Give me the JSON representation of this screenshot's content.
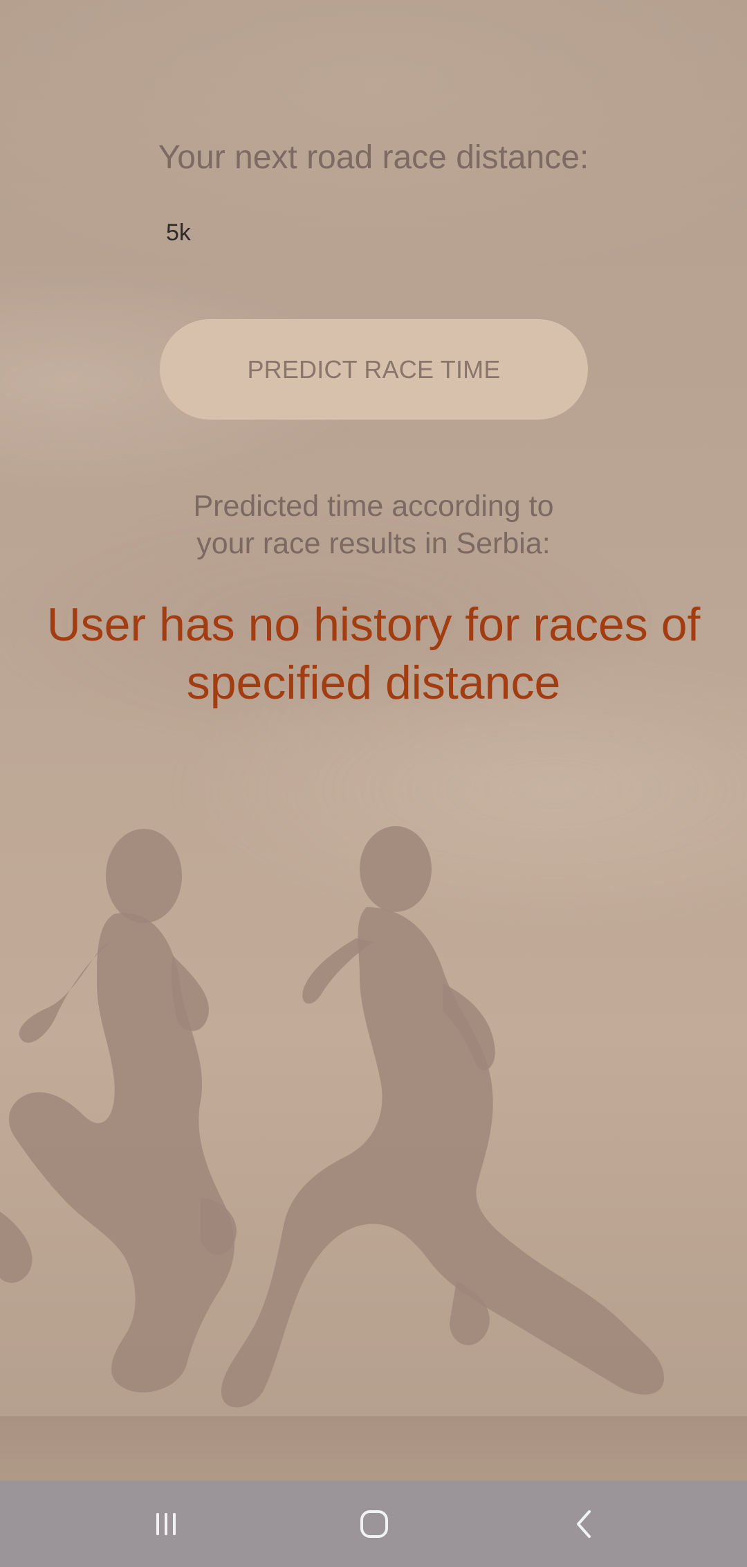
{
  "race_form": {
    "prompt_label": "Your next road race distance:",
    "distance_value": "5k"
  },
  "predict_button": {
    "label": "PREDICT RACE TIME"
  },
  "prediction": {
    "caption": "Predicted time according to\nyour race results in Serbia:",
    "result_message": "User has no history for races of\nspecified distance"
  },
  "navigation_bar": {
    "recents_icon": "recents-icon",
    "home_icon": "home-icon",
    "back_icon": "back-icon"
  },
  "colors": {
    "result_text": "#a23d12",
    "button_bg": "#d7c1ac",
    "secondary_text": "#7e6a62",
    "navbar_bg": "#9b9599"
  }
}
